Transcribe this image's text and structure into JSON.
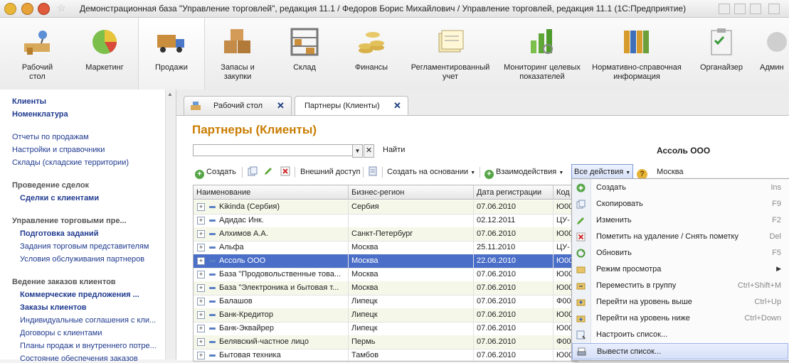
{
  "window": {
    "title": "Демонстрационная база \"Управление торговлей\", редакция 11.1 / Федоров Борис Михайлович / Управление торговлей, редакция 11.1  (1С:Предприятие)"
  },
  "sections": [
    {
      "label": "Рабочий стол",
      "icon": "desk-icon"
    },
    {
      "label": "Маркетинг",
      "icon": "pie-chart-icon"
    },
    {
      "label": "Продажи",
      "icon": "truck-icon"
    },
    {
      "label": "Запасы и закупки",
      "icon": "boxes-icon"
    },
    {
      "label": "Склад",
      "icon": "warehouse-shelf-icon"
    },
    {
      "label": "Финансы",
      "icon": "coins-icon"
    },
    {
      "label": "Регламентированный учет",
      "icon": "documents-icon"
    },
    {
      "label": "Мониторинг целевых показателей",
      "icon": "bar-chart-icon"
    },
    {
      "label": "Нормативно-справочная информация",
      "icon": "binders-icon"
    },
    {
      "label": "Органайзер",
      "icon": "clipboard-icon"
    },
    {
      "label": "Админ",
      "icon": "admin-icon"
    }
  ],
  "nav": {
    "top_links": [
      "Клиенты",
      "Номенклатура"
    ],
    "links": [
      "Отчеты по продажам",
      "Настройки и справочники",
      "Склады (складские территории)"
    ],
    "group1": {
      "title": "Проведение сделок",
      "items": [
        "Сделки с клиентами"
      ]
    },
    "group2": {
      "title": "Управление торговыми пре...",
      "items": [
        "Подготовка заданий",
        "Задания торговым представителям",
        "Условия обслуживания партнеров"
      ]
    },
    "group3": {
      "title": "Ведение заказов клиентов",
      "items": [
        "Коммерческие предложения ...",
        "Заказы клиентов",
        "Индивидуальные соглашения с кли...",
        "Договоры с клиентами",
        "Планы продаж и внутреннего потре...",
        "Состояние обеспечения заказов"
      ]
    }
  },
  "tabs": [
    {
      "label": "Рабочий стол",
      "close": "✕"
    },
    {
      "label": "Партнеры (Клиенты)",
      "close": "✕"
    }
  ],
  "form": {
    "title": "Партнеры (Клиенты)",
    "search_value": "",
    "find_label": "Найти",
    "selected_client": "Ассоль ООО",
    "selected_city": "Москва"
  },
  "toolbar": {
    "create": "Создать",
    "external_access": "Внешний доступ",
    "create_based_on": "Создать на основании",
    "interactions": "Взаимодействия",
    "all_actions": "Все действия"
  },
  "table": {
    "columns": [
      "Наименование",
      "Бизнес-регион",
      "Дата регистрации",
      "Код"
    ],
    "rows": [
      {
        "name": "Kikinda (Сербия)",
        "region": "Сербия",
        "date": "07.06.2010",
        "code": "Ю00"
      },
      {
        "name": "Адидас Инк.",
        "region": "",
        "date": "02.12.2011",
        "code": "ЦУ-"
      },
      {
        "name": "Алхимов А.А.",
        "region": "Санкт-Петербург",
        "date": "07.06.2010",
        "code": "Ю00"
      },
      {
        "name": "Альфа",
        "region": "Москва",
        "date": "25.11.2010",
        "code": "ЦУ-"
      },
      {
        "name": "Ассоль ООО",
        "region": "Москва",
        "date": "22.06.2010",
        "code": "Ю00",
        "selected": true
      },
      {
        "name": "База \"Продовольственные това...",
        "region": "Москва",
        "date": "07.06.2010",
        "code": "Ю00"
      },
      {
        "name": "База \"Электроника и бытовая т...",
        "region": "Москва",
        "date": "07.06.2010",
        "code": "Ю00"
      },
      {
        "name": "Балашов",
        "region": "Липецк",
        "date": "07.06.2010",
        "code": "Ф00"
      },
      {
        "name": "Банк-Кредитор",
        "region": "Липецк",
        "date": "07.06.2010",
        "code": "Ю00"
      },
      {
        "name": "Банк-Эквайрер",
        "region": "Липецк",
        "date": "07.06.2010",
        "code": "Ю00"
      },
      {
        "name": "Белявский-частное лицо",
        "region": "Пермь",
        "date": "07.06.2010",
        "code": "Ф00"
      },
      {
        "name": "Бытовая техника",
        "region": "Тамбов",
        "date": "07.06.2010",
        "code": "Ю00"
      }
    ]
  },
  "menu": {
    "items": [
      {
        "label": "Создать",
        "key": "Ins",
        "icon": "plus-icon"
      },
      {
        "label": "Скопировать",
        "key": "F9",
        "icon": "copy-icon"
      },
      {
        "label": "Изменить",
        "key": "F2",
        "icon": "pencil-icon"
      },
      {
        "label": "Пометить на удаление / Снять пометку",
        "key": "Del",
        "icon": "delete-mark-icon"
      },
      {
        "label": "Обновить",
        "key": "F5",
        "icon": "refresh-icon"
      },
      {
        "label": "Режим просмотра",
        "key": "",
        "icon": "view-mode-icon",
        "submenu": "▶"
      },
      {
        "label": "Переместить в группу",
        "key": "Ctrl+Shift+M",
        "icon": "move-to-group-icon"
      },
      {
        "label": "Перейти на уровень выше",
        "key": "Ctrl+Up",
        "icon": "level-up-icon"
      },
      {
        "label": "Перейти на уровень ниже",
        "key": "Ctrl+Down",
        "icon": "level-down-icon"
      },
      {
        "label": "Настроить список...",
        "key": "",
        "icon": "list-settings-icon"
      },
      {
        "label": "Вывести список...",
        "key": "",
        "icon": "print-list-icon"
      }
    ]
  },
  "colors": {
    "form_title": "#c97c00",
    "nav_link": "#1f3a8f",
    "selected_row": "#4b6fc8",
    "alt_row": "#f5f8e9"
  }
}
